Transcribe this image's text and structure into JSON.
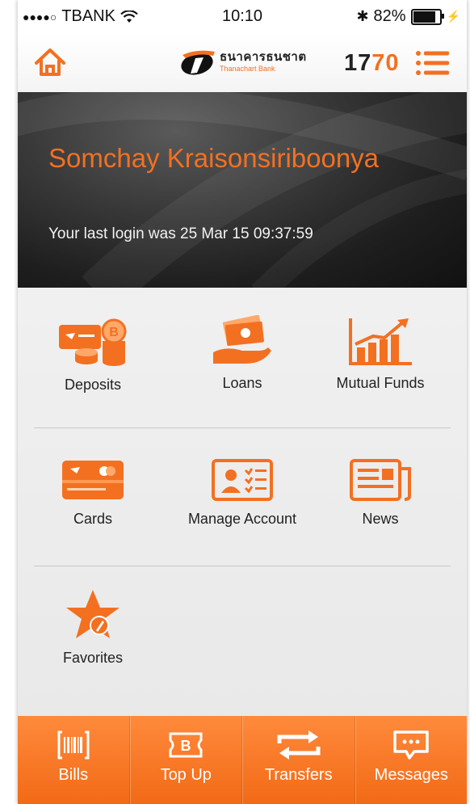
{
  "status_bar": {
    "carrier": "TBANK",
    "time": "10:10",
    "battery": "82%"
  },
  "header": {
    "bank_name_thai": "ธนาคารธนชาต",
    "bank_name_en": "Thanachart Bank",
    "hotline_prefix": "17",
    "hotline_suffix": "70"
  },
  "banner": {
    "user_name": "Somchay Kraisonsiriboonya",
    "last_login": "Your last login was 25 Mar 15  09:37:59"
  },
  "menu": {
    "deposits": "Deposits",
    "loans": "Loans",
    "mutual_funds": "Mutual Funds",
    "cards": "Cards",
    "manage_account": "Manage Account",
    "news": "News",
    "favorites": "Favorites"
  },
  "tabbar": {
    "bills": "Bills",
    "top_up": "Top Up",
    "transfers": "Transfers",
    "messages": "Messages"
  },
  "colors": {
    "accent": "#f37021",
    "banner_dark": "#1e1e1e"
  }
}
